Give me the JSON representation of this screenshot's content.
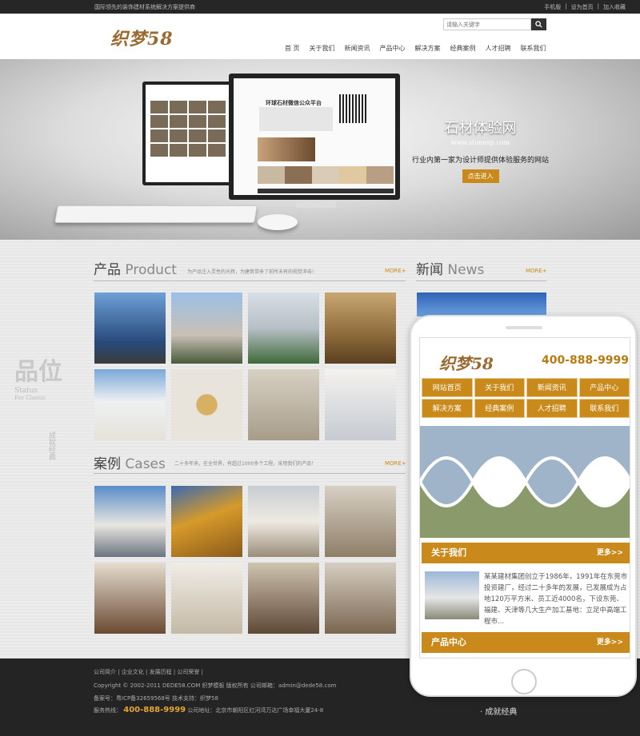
{
  "topbar": {
    "slogan": "国际领先的装饰建材系统解决方案提供商",
    "links": [
      "手机版",
      "设为首页",
      "加入收藏"
    ]
  },
  "header": {
    "logo": "织梦58",
    "search_placeholder": "请输入关键字",
    "nav": [
      "首 页",
      "关于我们",
      "新闻资讯",
      "产品中心",
      "解决方案",
      "经典案例",
      "人才招聘",
      "联系我们"
    ]
  },
  "banner": {
    "title": "石材体验网",
    "domain": "www.stonexp.com",
    "desc": "行业内第一家为设计师提供体验服务的网站",
    "button": "点击进入",
    "screen_title": "环球石材微信公众平台"
  },
  "products": {
    "title_cn": "产品",
    "title_en": "Product",
    "sub": "为产品注入灵性的光辉，为建筑带来了前所未有的视觉冲击!",
    "more": "MORE+"
  },
  "news": {
    "title_cn": "新闻",
    "title_en": "News",
    "more": "MORE+"
  },
  "cases": {
    "title_cn": "案例",
    "title_en": "Cases",
    "sub": "二十多年来，在全世界，有超过1000多个工程，采用我们的产品！",
    "more": "MORE+"
  },
  "side": {
    "big": "品位",
    "en1": "Status",
    "en2": "For Classic",
    "cn": "成就经典"
  },
  "footer": {
    "links": "公司简介 | 企业文化 | 发展历程 | 公司荣誉 |",
    "copyright": "Copyright © 2002-2011 DEDE58.COM 织梦模板 版权所有 公司邮箱：admin@dede58.com",
    "icp": "备案号：粤ICP备32659568号 技术支持：织梦58",
    "hotline_label": "服务热线：",
    "hotline": "400-888-9999",
    "address": "公司地址：北京市朝阳区红河湾万达广场幸福大厦24-8",
    "brand_cn": "· 成就经典"
  },
  "mobile": {
    "logo": "织梦58",
    "tel": "400-888-9999",
    "nav": [
      "网站首页",
      "关于我们",
      "新闻资讯",
      "产品中心",
      "解决方案",
      "经典案例",
      "人才招聘",
      "联系我们"
    ],
    "about_title": "关于我们",
    "more": "更多>>",
    "about_text": "某某建材集团创立于1986年，1991年在东莞市投资建厂，经过二十多年的发展，已发展成为占地120万平方米、员工近4000名，下设东莞、福建、天津等几大生产加工基地：立足中高端工程市...",
    "product_title": "产品中心"
  },
  "colors": {
    "accent": "#c98a1b",
    "dark": "#242424"
  }
}
